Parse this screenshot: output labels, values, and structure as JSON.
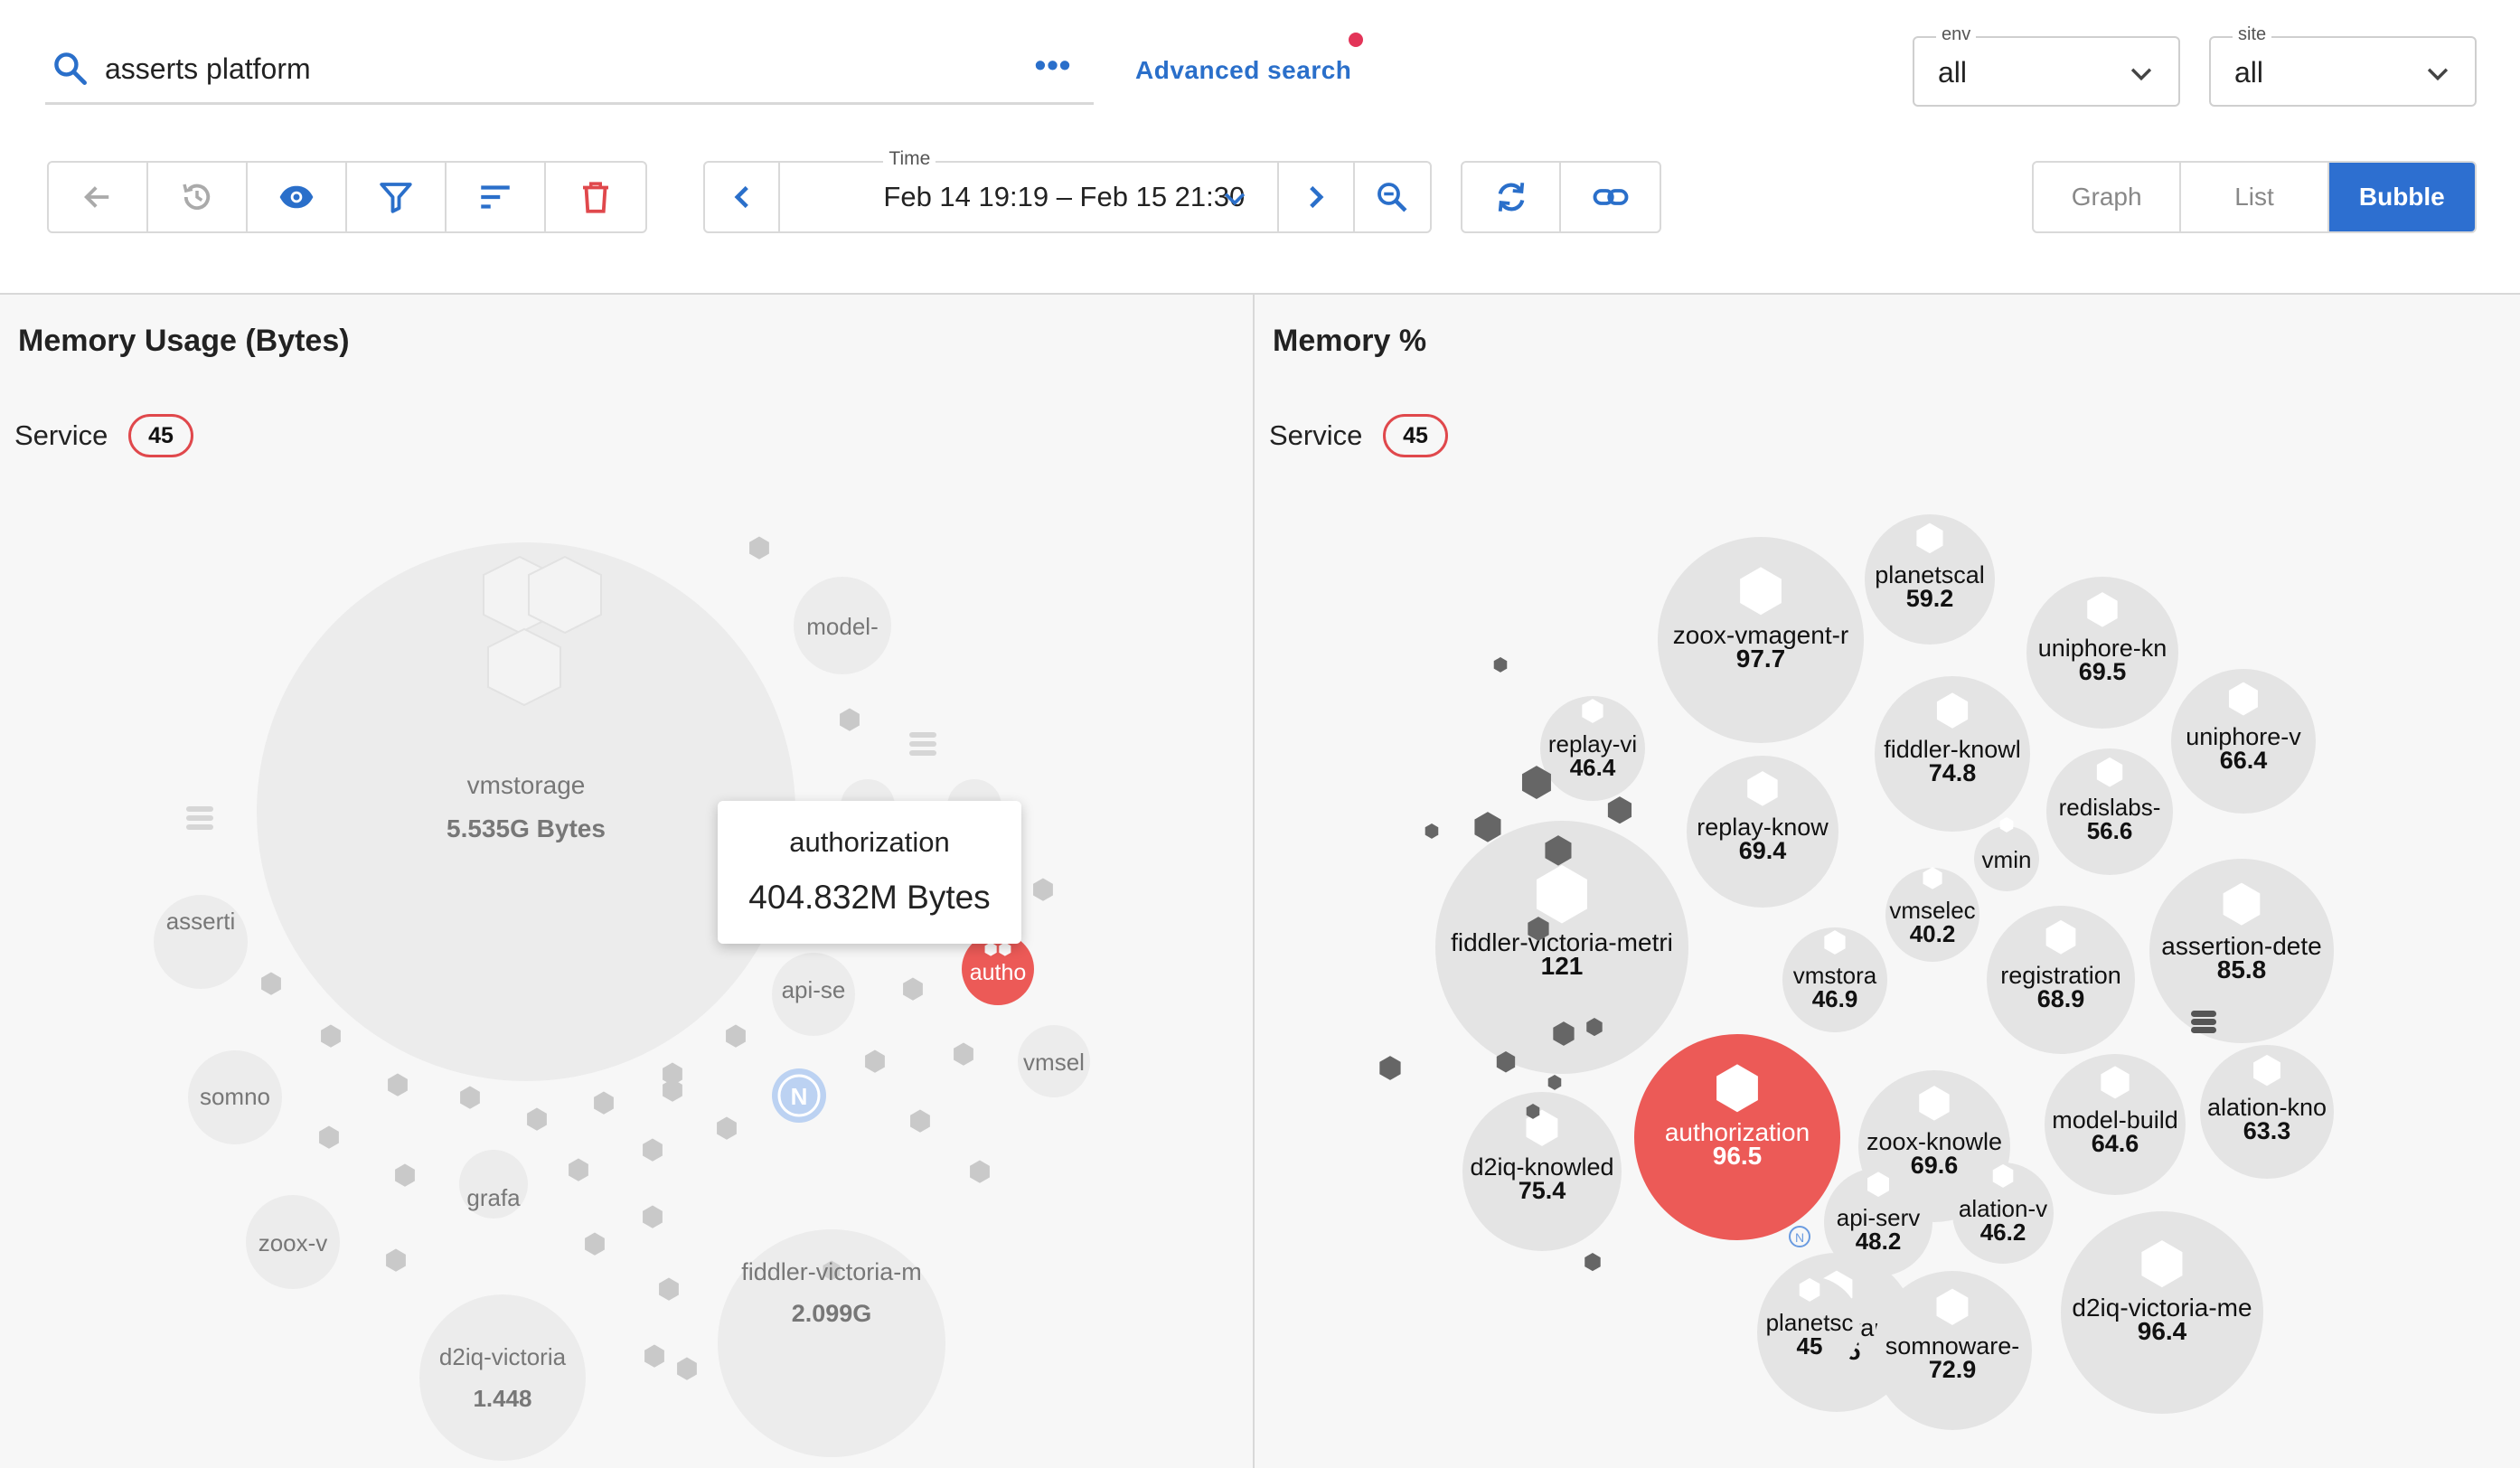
{
  "search": {
    "query": "asserts platform",
    "more_label": "•••",
    "advanced_label": "Advanced search"
  },
  "filters": [
    {
      "label": "env",
      "value": "all"
    },
    {
      "label": "site",
      "value": "all"
    }
  ],
  "time": {
    "label": "Time",
    "value": "Feb 14 19:19 – Feb 15 21:30"
  },
  "views": [
    {
      "label": "Graph",
      "active": false
    },
    {
      "label": "List",
      "active": false
    },
    {
      "label": "Bubble",
      "active": true
    }
  ],
  "colors": {
    "accent": "#2d6fd0",
    "highlight": "#ec5a57",
    "bubble": "#e4e4e4",
    "badge_border": "#e0484c"
  },
  "panels": [
    {
      "title": "Memory Usage (Bytes)",
      "service_label": "Service",
      "count": "45",
      "tooltip": {
        "name": "authorization",
        "value": "404.832M Bytes"
      },
      "bubbles": [
        {
          "name": "vmstorage",
          "value": "5.535G Bytes"
        },
        {
          "name": "fiddler-victoria-m",
          "value": "2.099G"
        },
        {
          "name": "d2iq-victoria",
          "value": "1.448"
        },
        {
          "name": "model-",
          "value": ""
        },
        {
          "name": "asserti",
          "value": ""
        },
        {
          "name": "somno",
          "value": ""
        },
        {
          "name": "zoox-v",
          "value": ""
        },
        {
          "name": "grafa",
          "value": ""
        },
        {
          "name": "api-se",
          "value": ""
        },
        {
          "name": "vmsel",
          "value": ""
        },
        {
          "name": "autho",
          "value": "",
          "highlight": true
        }
      ]
    },
    {
      "title": "Memory %",
      "service_label": "Service",
      "count": "45",
      "bubbles": [
        {
          "name": "fiddler-victoria-metri",
          "value": "121"
        },
        {
          "name": "zoox-vmagent-r",
          "value": "97.7"
        },
        {
          "name": "authorization",
          "value": "96.5",
          "highlight": true
        },
        {
          "name": "d2iq-victoria-me",
          "value": "96.4"
        },
        {
          "name": "assertion-dete",
          "value": "85.8"
        },
        {
          "name": "d2iq-knowled",
          "value": "75.4"
        },
        {
          "name": "fiddler-knowl",
          "value": "74.8"
        },
        {
          "name": "somnoware-",
          "value": "74.5"
        },
        {
          "name": "somnoware-",
          "value": "72.9"
        },
        {
          "name": "uniphore-kn",
          "value": "69.5"
        },
        {
          "name": "replay-know",
          "value": "69.4"
        },
        {
          "name": "zoox-knowle",
          "value": "69.6"
        },
        {
          "name": "registration",
          "value": "68.9"
        },
        {
          "name": "uniphore-v",
          "value": "66.4"
        },
        {
          "name": "model-build",
          "value": "64.6"
        },
        {
          "name": "alation-kno",
          "value": "63.3"
        },
        {
          "name": "planetscal",
          "value": "59.2"
        },
        {
          "name": "redislabs-",
          "value": "56.6"
        },
        {
          "name": "api-serv",
          "value": "48.2"
        },
        {
          "name": "vmstora",
          "value": "46.9"
        },
        {
          "name": "replay-vi",
          "value": "46.4"
        },
        {
          "name": "alation-v",
          "value": "46.2"
        },
        {
          "name": "planetsc",
          "value": "45"
        },
        {
          "name": "vmselec",
          "value": "40.2"
        },
        {
          "name": "vmin",
          "value": ""
        }
      ]
    }
  ]
}
